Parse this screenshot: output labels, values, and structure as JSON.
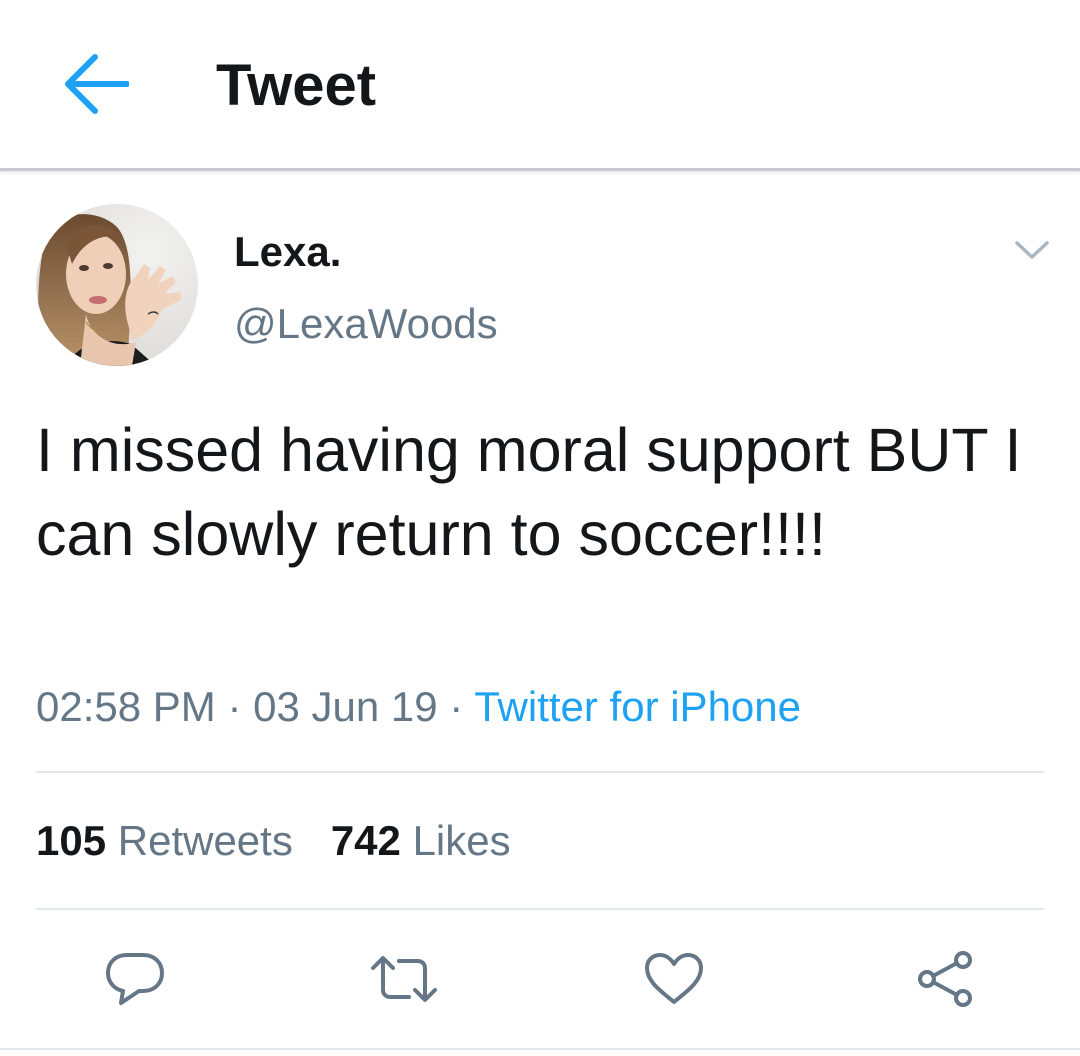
{
  "header": {
    "title": "Tweet"
  },
  "tweet": {
    "display_name": "Lexa.",
    "handle": "@LexaWoods",
    "text": "I missed having moral support BUT I can slowly return to soccer!!!!",
    "time": "02:58 PM",
    "date": "03 Jun 19",
    "separator": " · ",
    "source": "Twitter for iPhone",
    "retweets_count": "105",
    "retweets_label": "Retweets",
    "likes_count": "742",
    "likes_label": "Likes"
  },
  "icons": {
    "back": "arrow-left-icon",
    "caret": "chevron-down-icon",
    "reply": "reply-bubble-icon",
    "retweet": "retweet-icon",
    "like": "heart-icon",
    "share": "share-icon"
  },
  "colors": {
    "accent": "#1da1f2",
    "primary_text": "#14171a",
    "secondary_text": "#657786",
    "icon_gray": "#657786",
    "divider": "#e1e8ed"
  }
}
